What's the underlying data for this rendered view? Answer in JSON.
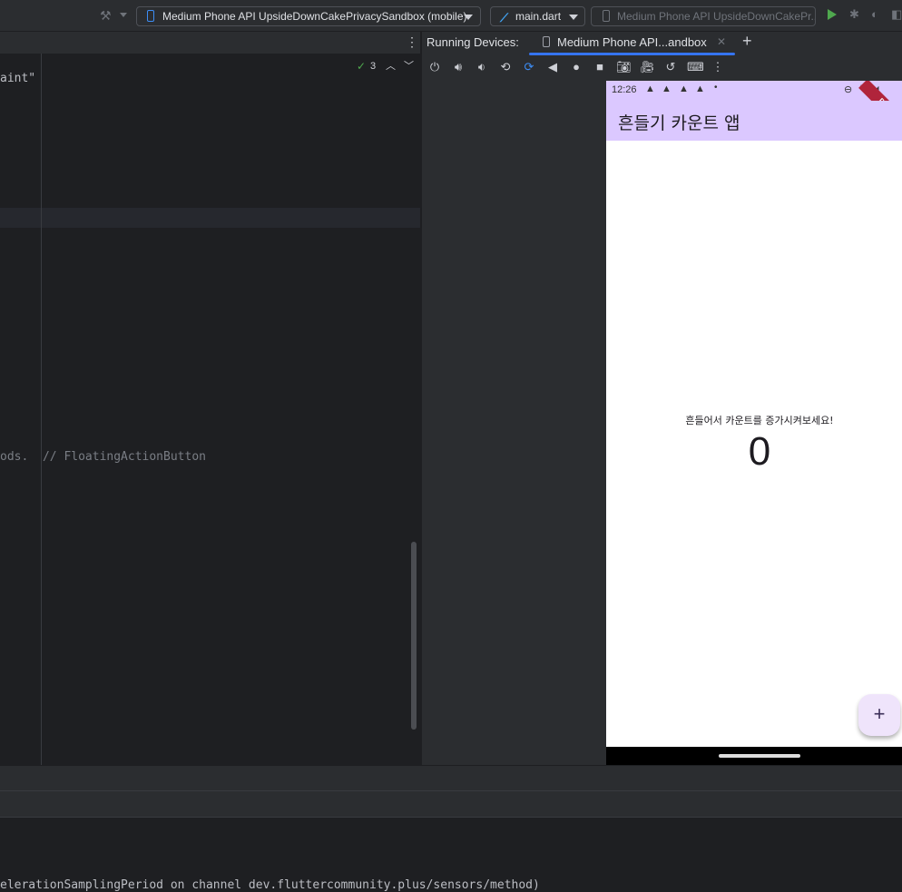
{
  "toolbar": {
    "device_select": "Medium Phone API UpsideDownCakePrivacySandbox (mobile)",
    "file_select": "main.dart",
    "device_disabled": "Medium Phone API UpsideDownCakePr..."
  },
  "editor": {
    "line_top": "aint\"",
    "line_mid": "ods.  // FloatingActionButton",
    "inspection_count": "3",
    "console_line": "elerationSamplingPeriod on channel dev.fluttercommunity.plus/sensors/method)"
  },
  "running_devices": {
    "title": "Running Devices:",
    "tab_label": "Medium Phone API...andbox"
  },
  "phone": {
    "time": "12:26",
    "app_title": "흔들기 카운트 앱",
    "prompt_text": "흔들어서 카운트를 증가시켜보세요!",
    "count": "0",
    "fab_symbol": "+",
    "debug_label": "DEBUG"
  },
  "colors": {
    "appbar": "#dbc8ff",
    "accent": "#3574f0",
    "run": "#4fa84e"
  }
}
